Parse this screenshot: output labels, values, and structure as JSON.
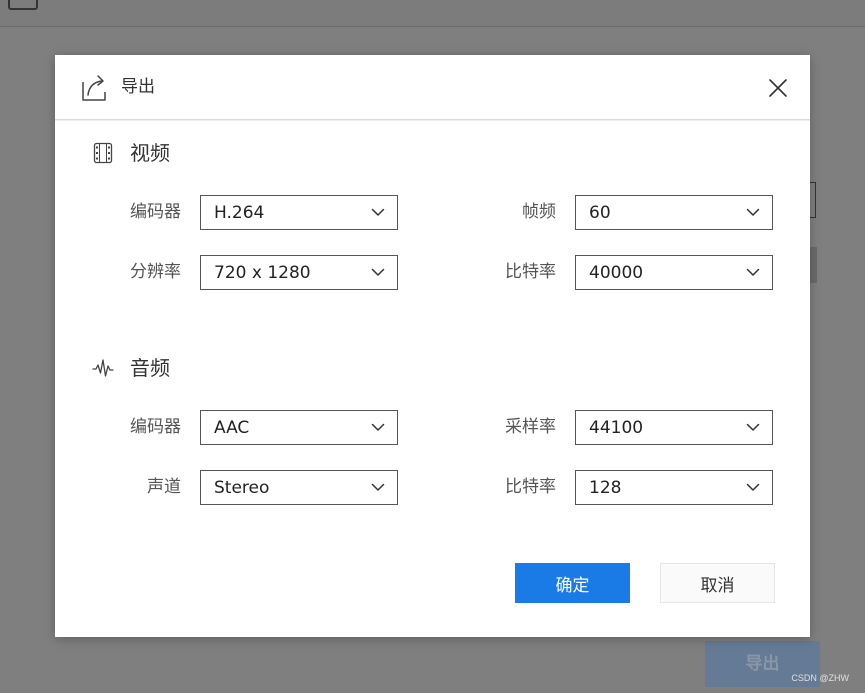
{
  "background": {
    "export_button_label": "导出",
    "watermark": "CSDN @ZHW"
  },
  "dialog": {
    "title": "导出",
    "icons": {
      "header": "export-share-icon",
      "close": "close-icon"
    },
    "video": {
      "title": "视频",
      "icon": "film-strip-icon",
      "encoder": {
        "label": "编码器",
        "value": "H.264"
      },
      "framerate": {
        "label": "帧频",
        "value": "60"
      },
      "resolution": {
        "label": "分辨率",
        "value": "720 x 1280"
      },
      "bitrate": {
        "label": "比特率",
        "value": "40000"
      }
    },
    "audio": {
      "title": "音频",
      "icon": "audio-wave-icon",
      "encoder": {
        "label": "编码器",
        "value": "AAC"
      },
      "samplerate": {
        "label": "采样率",
        "value": "44100"
      },
      "channel": {
        "label": "声道",
        "value": "Stereo"
      },
      "bitrate": {
        "label": "比特率",
        "value": "128"
      }
    },
    "confirm_label": "确定",
    "cancel_label": "取消"
  },
  "colors": {
    "accent": "#1a7ae6",
    "overlay": "#7f7f7f",
    "dialog_bg": "#ffffff"
  }
}
